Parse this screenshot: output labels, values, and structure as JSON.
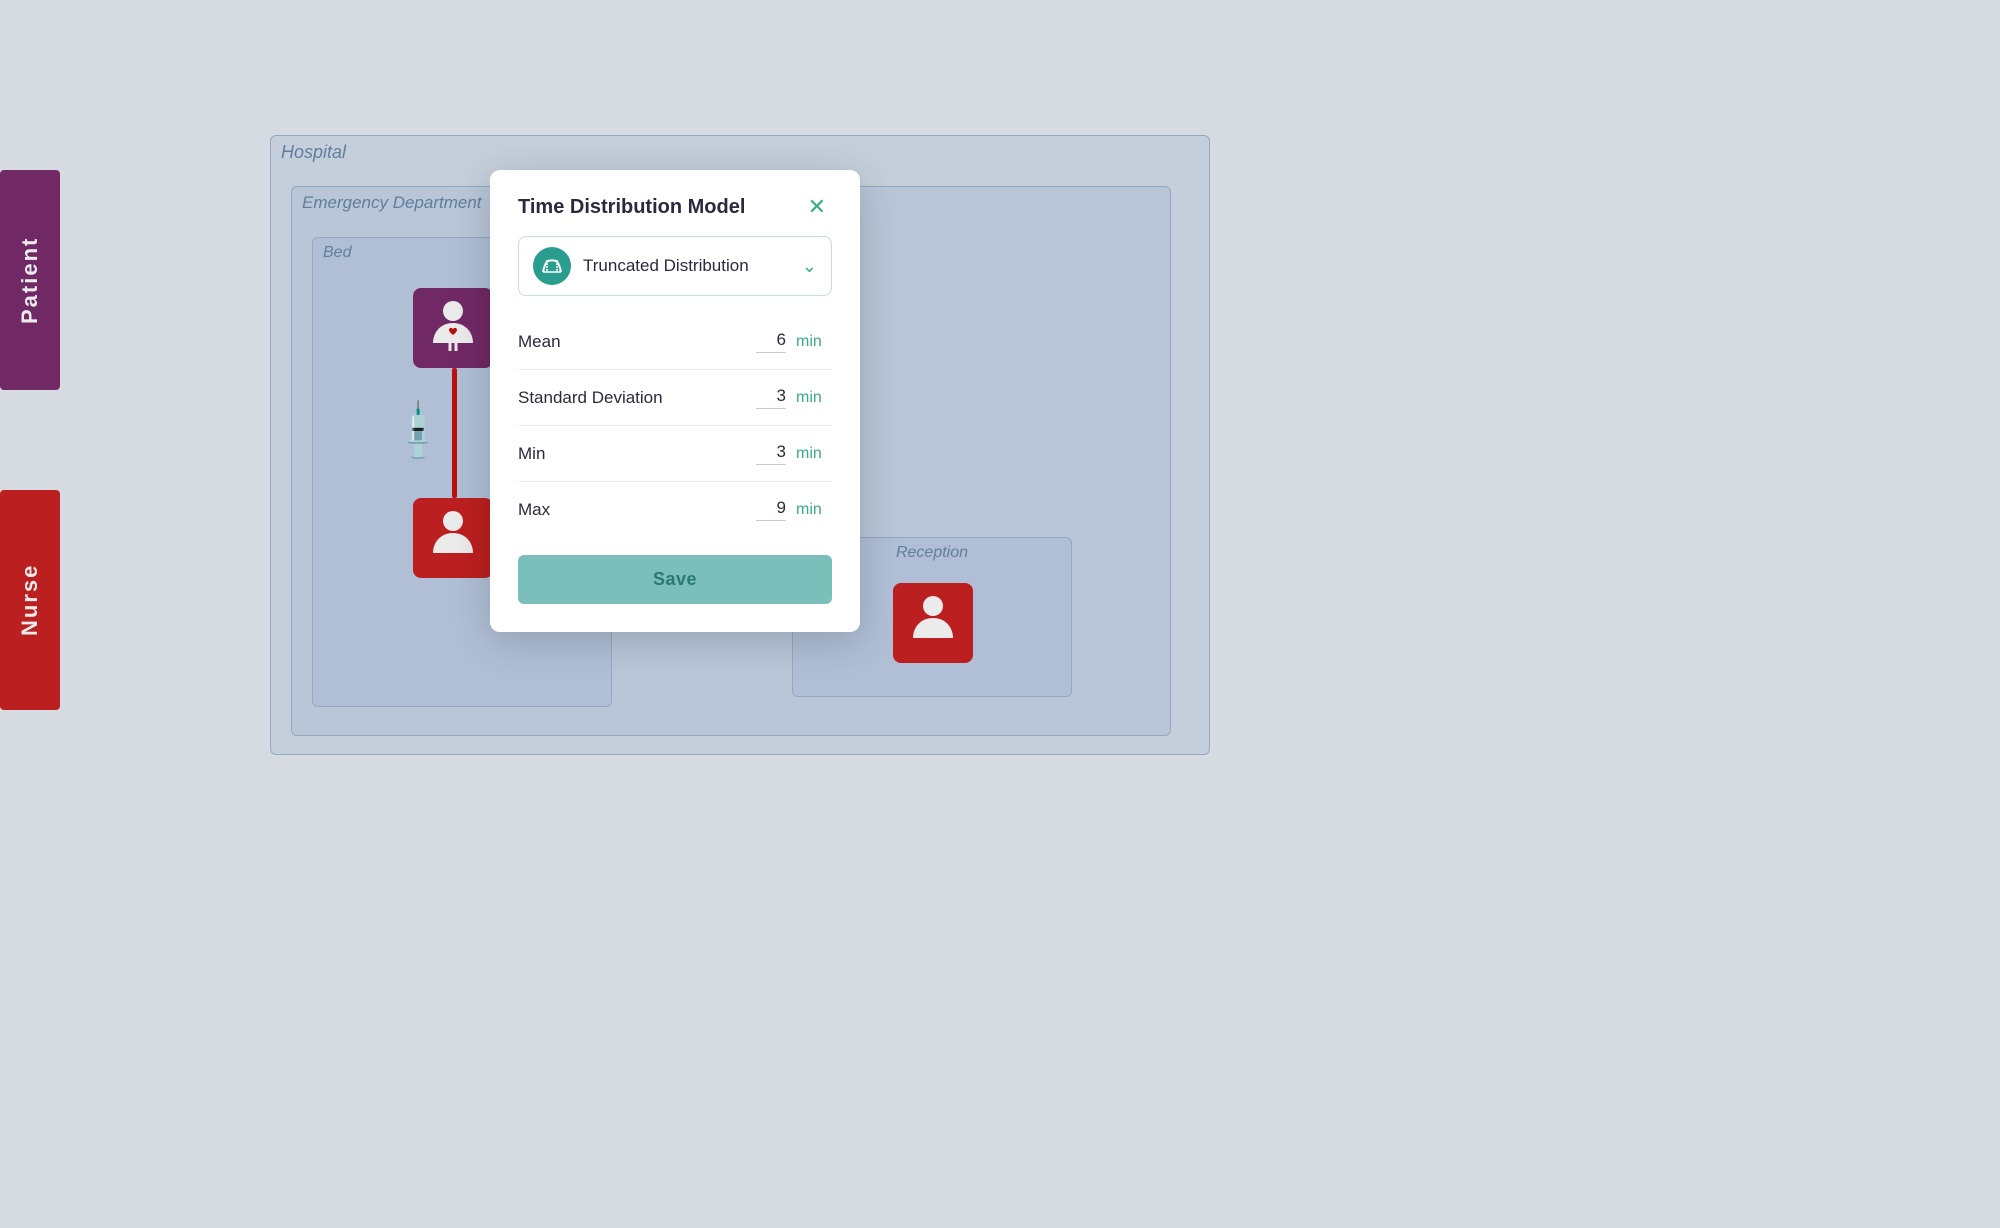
{
  "sidebar": {
    "patient_label": "Patient",
    "nurse_label": "Nurse"
  },
  "hospital": {
    "label": "Hospital",
    "ed_label": "Emergency Department",
    "bed_label": "Bed",
    "reception_label": "Reception"
  },
  "modal": {
    "title": "Time Distribution Model",
    "distribution_name": "Truncated Distribution",
    "close_label": "✕",
    "chevron": "⌄",
    "params": [
      {
        "label": "Mean",
        "value": "6",
        "unit": "min"
      },
      {
        "label": "Standard Deviation",
        "value": "3",
        "unit": "min"
      },
      {
        "label": "Min",
        "value": "3",
        "unit": "min"
      },
      {
        "label": "Max",
        "value": "9",
        "unit": "min"
      }
    ],
    "save_label": "Save"
  }
}
